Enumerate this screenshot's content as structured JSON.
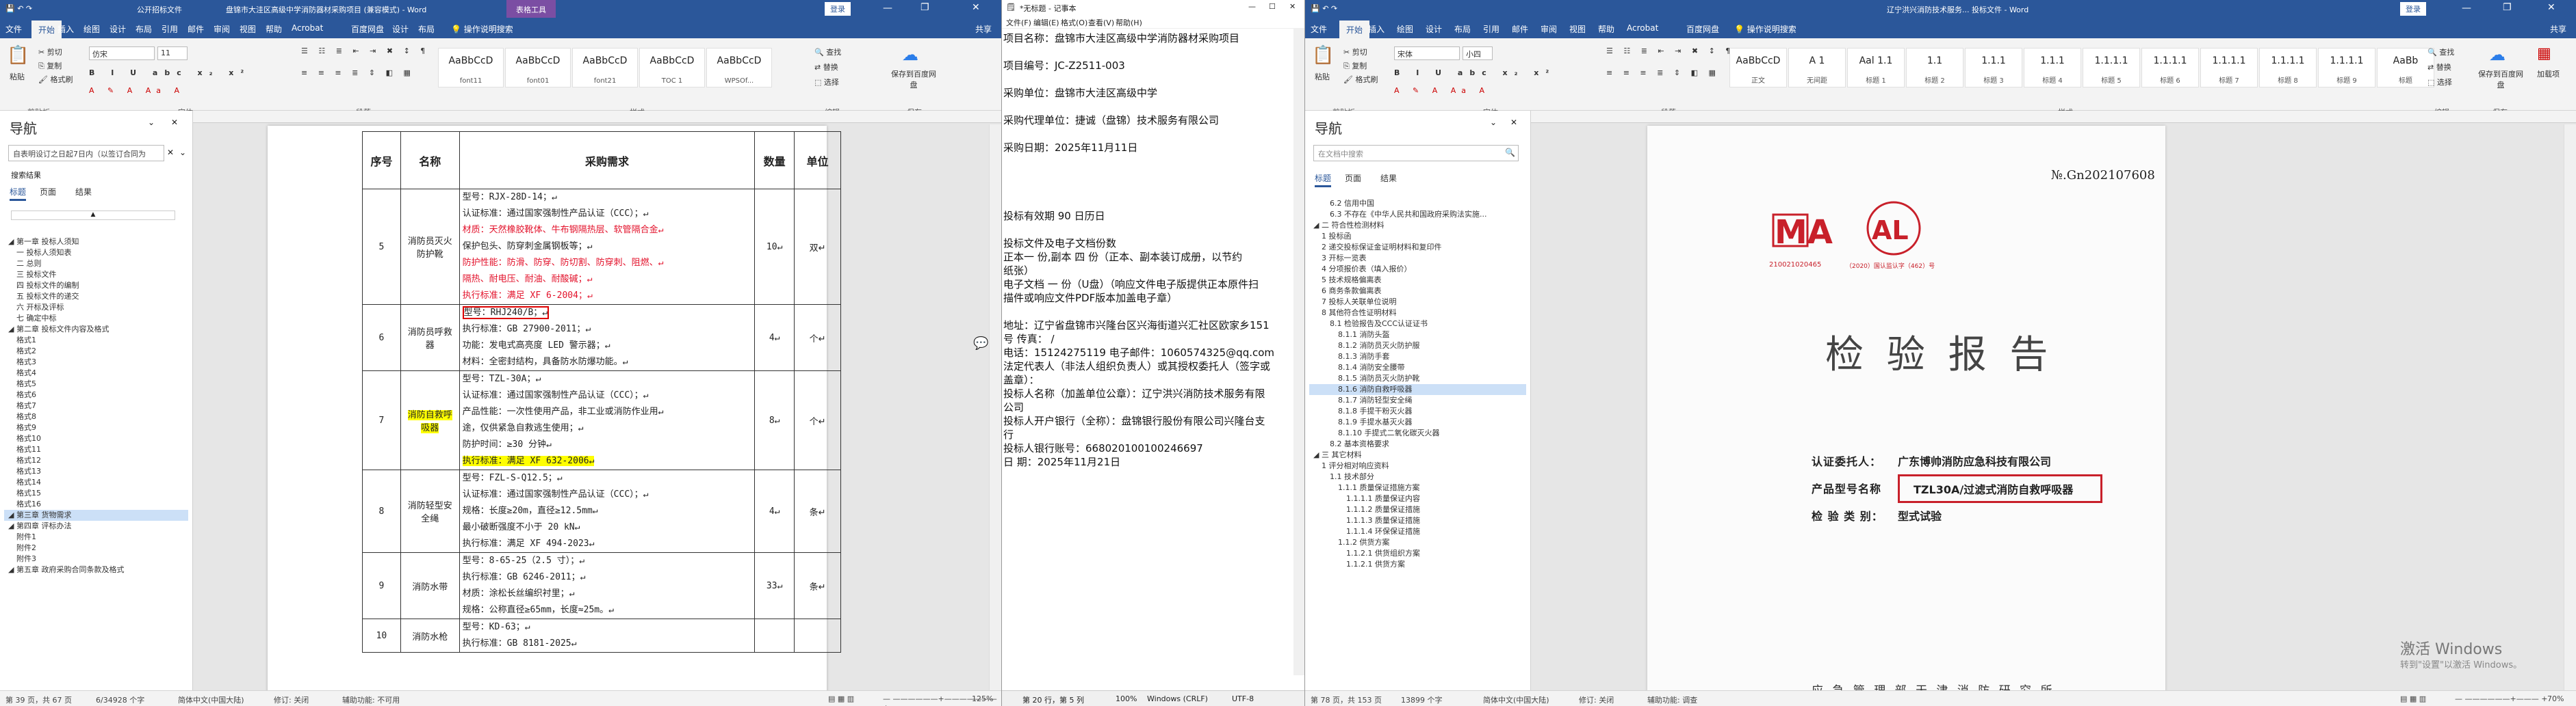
{
  "word_left": {
    "title_left": "公开招标文件",
    "title": "盘锦市大洼区高级中学消防器材采购项目 (兼容模式) - Word",
    "table_tools": "表格工具",
    "signin": "登录",
    "tabs": [
      "文件",
      "开始",
      "插入",
      "绘图",
      "设计",
      "布局",
      "引用",
      "邮件",
      "审阅",
      "视图",
      "帮助",
      "Acrobat",
      "百度网盘",
      "设计",
      "布局"
    ],
    "tell_me": "操作说明搜索",
    "share": "共享",
    "ribbon": {
      "paste": "粘贴",
      "cut": "剪切",
      "copy": "复制",
      "format_painter": "格式刷",
      "clipboard": "剪贴板",
      "font_name": "仿宋",
      "font_size": "11",
      "font": "字体",
      "paragraph": "段落",
      "styles_group": "样式",
      "styles": [
        {
          "sample": "AaBbCcD",
          "label": "font11"
        },
        {
          "sample": "AaBbCcD",
          "label": "font01"
        },
        {
          "sample": "AaBbCcD",
          "label": "font21"
        },
        {
          "sample": "AaBbCcD",
          "label": "TOC 1"
        },
        {
          "sample": "AaBbCcD",
          "label": "WPSOf..."
        }
      ],
      "find": "查找",
      "replace": "替换",
      "select": "选择",
      "editing": "编辑",
      "save_baidu": "保存到百度网盘",
      "save": "保存"
    },
    "nav": {
      "title": "导航",
      "search_value": "自表明设订之日起7日内（以签订合同为",
      "result_label": "搜索结果",
      "tabs": [
        "标题",
        "页面",
        "结果"
      ],
      "items": [
        {
          "text": "第一章 投标人须知",
          "level": 0
        },
        {
          "text": "一 投标人须知表",
          "level": 1
        },
        {
          "text": "二 总则",
          "level": 1
        },
        {
          "text": "三 投标文件",
          "level": 1
        },
        {
          "text": "四 投标文件的编制",
          "level": 1
        },
        {
          "text": "五 投标文件的递交",
          "level": 1
        },
        {
          "text": "六 开标及评标",
          "level": 1
        },
        {
          "text": "七 确定中标",
          "level": 1
        },
        {
          "text": "第二章 投标文件内容及格式",
          "level": 0
        },
        {
          "text": "格式1",
          "level": 1
        },
        {
          "text": "格式2",
          "level": 1
        },
        {
          "text": "格式3",
          "level": 1
        },
        {
          "text": "格式4",
          "level": 1
        },
        {
          "text": "格式5",
          "level": 1
        },
        {
          "text": "格式6",
          "level": 1
        },
        {
          "text": "格式7",
          "level": 1
        },
        {
          "text": "格式8",
          "level": 1
        },
        {
          "text": "格式9",
          "level": 1
        },
        {
          "text": "格式10",
          "level": 1
        },
        {
          "text": "格式11",
          "level": 1
        },
        {
          "text": "格式12",
          "level": 1
        },
        {
          "text": "格式13",
          "level": 1
        },
        {
          "text": "格式14",
          "level": 1
        },
        {
          "text": "格式15",
          "level": 1
        },
        {
          "text": "格式16",
          "level": 1
        },
        {
          "text": "第三章 货物需求",
          "level": 0,
          "sel": true
        },
        {
          "text": "第四章 评标办法",
          "level": 0
        },
        {
          "text": "附件1",
          "level": 1
        },
        {
          "text": "附件2",
          "level": 1
        },
        {
          "text": "附件3",
          "level": 1
        },
        {
          "text": "第五章 政府采购合同条款及格式",
          "level": 0
        }
      ]
    },
    "table": {
      "headers": [
        "序号",
        "名称",
        "采购需求",
        "数量",
        "单位"
      ],
      "rows": [
        {
          "no": "5",
          "name": "消防员灭火防护靴",
          "qty": "10",
          "unit": "双",
          "lines": [
            {
              "t": "型号：RJX-28D-14；"
            },
            {
              "t": "认证标准：通过国家强制性产品认证（CCC）；"
            },
            {
              "t": "材质：天然橡胶靴体、牛布钢隔热层、软管隔合金",
              "red": true
            },
            {
              "t": "保护包头、防穿刺金属钢板等；"
            },
            {
              "t": "防护性能：防滑、防穿、防切割、防穿刺、阻燃、",
              "red": true
            },
            {
              "t": "隔热、耐电压、耐油、耐酸碱；",
              "red": true
            },
            {
              "t": "执行标准：满足 XF 6-2004；",
              "red": true
            }
          ]
        },
        {
          "no": "6",
          "name": "消防员呼救器",
          "qty": "4",
          "unit": "个",
          "lines": [
            {
              "t": "型号：RHJ240/B；",
              "box": true
            },
            {
              "t": "执行标准：GB 27900-2011；"
            },
            {
              "t": "功能：发电式高亮度 LED 警示器；"
            },
            {
              "t": "材料：全密封结构，具备防水防爆功能。"
            }
          ]
        },
        {
          "no": "7",
          "name": "消防自救呼吸器",
          "name_hl": true,
          "qty": "8",
          "unit": "个",
          "lines": [
            {
              "t": "型号：TZL-30A；"
            },
            {
              "t": "认证标准：通过国家强制性产品认证（CCC）；"
            },
            {
              "t": "产品性能：一次性使用产品，非工业或消防作业用"
            },
            {
              "t": "途，仅供紧急自救逃生使用；"
            },
            {
              "t": "防护时间：≥30 分钟"
            },
            {
              "t": "执行标准：满足 XF 632-2006",
              "hl": true
            }
          ]
        },
        {
          "no": "8",
          "name": "消防轻型安全绳",
          "qty": "4",
          "unit": "条",
          "lines": [
            {
              "t": "型号：FZL-S-Q12.5；"
            },
            {
              "t": "认证标准：通过国家强制性产品认证（CCC）；"
            },
            {
              "t": "规格：长度≥20m，直径≥12.5mm"
            },
            {
              "t": "最小破断强度不小于 20 kN"
            },
            {
              "t": "执行标准：满足 XF 494-2023"
            }
          ]
        },
        {
          "no": "9",
          "name": "消防水带",
          "qty": "33",
          "unit": "条",
          "lines": [
            {
              "t": "型号：8-65-25（2.5 寸）；"
            },
            {
              "t": "执行标准：GB 6246-2011；"
            },
            {
              "t": "材质：涂松长丝编织衬里；"
            },
            {
              "t": "规格：公称直径≥65mm，长度≈25m。"
            }
          ]
        },
        {
          "no": "10",
          "name": "消防水枪",
          "qty": "",
          "unit": "",
          "lines": [
            {
              "t": "型号：KD-63；"
            },
            {
              "t": "执行标准：GB 8181-2025"
            }
          ]
        }
      ]
    },
    "status": {
      "page": "第 39 页，共 67 页",
      "words": "6/34928 个字",
      "lang": "简体中文(中国大陆)",
      "track": "修订: 关闭",
      "access": "辅助功能: 不可用",
      "zoom": "125%"
    }
  },
  "notepad": {
    "title": "*无标题 - 记事本",
    "menu": [
      "文件(F)",
      "编辑(E)",
      "格式(O)",
      "查看(V)",
      "帮助(H)"
    ],
    "lines": [
      "项目名称：盘锦市大洼区高级中学消防器材采购项目",
      "",
      "项目编号：JC-Z2511-003",
      "",
      "采购单位：盘锦市大洼区高级中学",
      "",
      "采购代理单位：捷诚（盘锦）技术服务有限公司",
      "",
      "采购日期：2025年11月11日",
      "",
      "",
      "",
      "",
      "投标有效期          90  日历日",
      "",
      "投标文件及电子文档份数",
      "正本一 份,副本  四  份（正本、副本装订成册，以节约",
      "纸张）",
      "电子文档 一 份（U盘）（响应文件电子版提供正本原件扫",
      "描件或响应文件PDF版本加盖电子章）",
      "",
      "地址：辽宁省盘锦市兴隆台区兴海街道兴汇社区欧家乡151",
      "号          传真：        /",
      "电话：15124275119      电子邮件：1060574325@qq.com",
      "法定代表人（非法人组织负责人）或其授权委托人（签字或",
      "盖章）：",
      "投标人名称（加盖单位公章）：辽宁洪兴消防技术服务有限",
      "公司",
      "投标人开户银行（全称）：盘锦银行股份有限公司兴隆台支",
      "行",
      "投标人银行账号：668020100100246697",
      "日    期：2025年11月21日"
    ],
    "status": {
      "pos": "第 20 行，第 5 列",
      "zoom": "100%",
      "eol": "Windows (CRLF)",
      "enc": "UTF-8"
    }
  },
  "word_right": {
    "title": "辽宁洪兴消防技术服务... 投标文件 - Word",
    "signin": "登录",
    "tabs": [
      "文件",
      "开始",
      "插入",
      "绘图",
      "设计",
      "布局",
      "引用",
      "邮件",
      "审阅",
      "视图",
      "帮助",
      "Acrobat",
      "百度网盘"
    ],
    "tell_me": "操作说明搜索",
    "share": "共享",
    "ribbon": {
      "paste": "粘贴",
      "cut": "剪切",
      "copy": "复制",
      "format_painter": "格式刷",
      "clipboard": "剪贴板",
      "font_name": "宋体",
      "font_size": "小四",
      "font": "字体",
      "paragraph": "段落",
      "styles_group": "样式",
      "styles": [
        {
          "sample": "AaBbCcD",
          "label": "正文"
        },
        {
          "sample": "A 1",
          "label": "无间距"
        },
        {
          "sample": "Aal 1.1",
          "label": "标题 1"
        },
        {
          "sample": "1.1",
          "label": "标题 2"
        },
        {
          "sample": "1.1.1",
          "label": "标题 3"
        },
        {
          "sample": "1.1.1",
          "label": "标题 4"
        },
        {
          "sample": "1.1.1.1",
          "label": "标题 5"
        },
        {
          "sample": "1.1.1.1",
          "label": "标题 6"
        },
        {
          "sample": "1.1.1.1",
          "label": "标题 7"
        },
        {
          "sample": "1.1.1.1",
          "label": "标题 8"
        },
        {
          "sample": "1.1.1.1",
          "label": "标题 9"
        },
        {
          "sample": "AaBb",
          "label": "标题"
        }
      ],
      "find": "查找",
      "replace": "替换",
      "select": "选择",
      "editing": "编辑",
      "save_baidu": "保存到百度网盘",
      "save": "保存",
      "addins": "加载项"
    },
    "nav": {
      "title": "导航",
      "search_placeholder": "在文档中搜索",
      "tabs": [
        "标题",
        "页面",
        "结果"
      ],
      "items": [
        {
          "text": "6.2 信用中国",
          "level": 2
        },
        {
          "text": "6.3 不存在《中华人民共和国政府采购法实施...",
          "level": 2
        },
        {
          "text": "二 符合性检测材料",
          "level": 0
        },
        {
          "text": "1 投标函",
          "level": 1
        },
        {
          "text": "2 递交投标保证金证明材料和复印件",
          "level": 1
        },
        {
          "text": "3 开标一览表",
          "level": 1
        },
        {
          "text": "4 分项报价表（填入报价）",
          "level": 1
        },
        {
          "text": "5 技术规格偏离表",
          "level": 1
        },
        {
          "text": "6 商务条款偏离表",
          "level": 1
        },
        {
          "text": "7 投标人关联单位说明",
          "level": 1
        },
        {
          "text": "8 其他符合性证明材料",
          "level": 1
        },
        {
          "text": "8.1 检验报告及CCC认证证书",
          "level": 2
        },
        {
          "text": "8.1.1 消防头盔",
          "level": 3
        },
        {
          "text": "8.1.2 消防员灭火防护服",
          "level": 3
        },
        {
          "text": "8.1.3 消防手套",
          "level": 3
        },
        {
          "text": "8.1.4 消防安全腰带",
          "level": 3
        },
        {
          "text": "8.1.5 消防员灭火防护靴",
          "level": 3
        },
        {
          "text": "8.1.6 消防自救呼吸器",
          "level": 3,
          "sel": true
        },
        {
          "text": "8.1.7 消防轻型安全绳",
          "level": 3
        },
        {
          "text": "8.1.8 手提干粉灭火器",
          "level": 3
        },
        {
          "text": "8.1.9 手提水基灭火器",
          "level": 3
        },
        {
          "text": "8.1.10 手提式二氧化碳灭火器",
          "level": 3
        },
        {
          "text": "8.2 基本资格要求",
          "level": 2
        },
        {
          "text": "三 其它材料",
          "level": 0
        },
        {
          "text": "1 评分相对响应资料",
          "level": 1
        },
        {
          "text": "1.1 技术部分",
          "level": 2
        },
        {
          "text": "1.1.1 质量保证措施方案",
          "level": 3
        },
        {
          "text": "1.1.1.1 质量保证内容",
          "level": 4
        },
        {
          "text": "1.1.1.2 质量保证措施",
          "level": 4
        },
        {
          "text": "1.1.1.3 质量保证措施",
          "level": 4
        },
        {
          "text": "1.1.1.4 环保保证措施",
          "level": 4
        },
        {
          "text": "1.1.2 供货方案",
          "level": 3
        },
        {
          "text": "1.1.2.1 供货组织方案",
          "level": 4
        },
        {
          "text": "1.1.2.1 供货方案",
          "level": 4
        }
      ]
    },
    "cert": {
      "no": "№.Gn202107608",
      "cma_code": "210021020465",
      "cal_code": "（2020）国认监认字（462）号",
      "title": "检 验 报 告",
      "rows": [
        {
          "label": "认证委托人：",
          "value": "广东博帅消防应急科技有限公司"
        },
        {
          "label": "产品型号名称",
          "value": "TZL30A/过滤式消防自救呼吸器",
          "boxed": true
        },
        {
          "label": "检 验 类 别：",
          "value": "型式试验"
        }
      ],
      "footer": "应 急 管 理 部 天 津 消 防 研 究 所"
    },
    "watermark": {
      "line1": "激活 Windows",
      "line2": "转到\"设置\"以激活 Windows。"
    },
    "status": {
      "page": "第 78 页，共 153 页",
      "words": "13899 个字",
      "lang": "简体中文(中国大陆)",
      "track": "修订: 关闭",
      "access": "辅助功能: 调查",
      "zoom": "70%"
    }
  },
  "colors": {
    "word_blue": "#2b579a",
    "red": "#e3122b",
    "highlight": "#ffff00",
    "cert_red": "#c8202a"
  }
}
